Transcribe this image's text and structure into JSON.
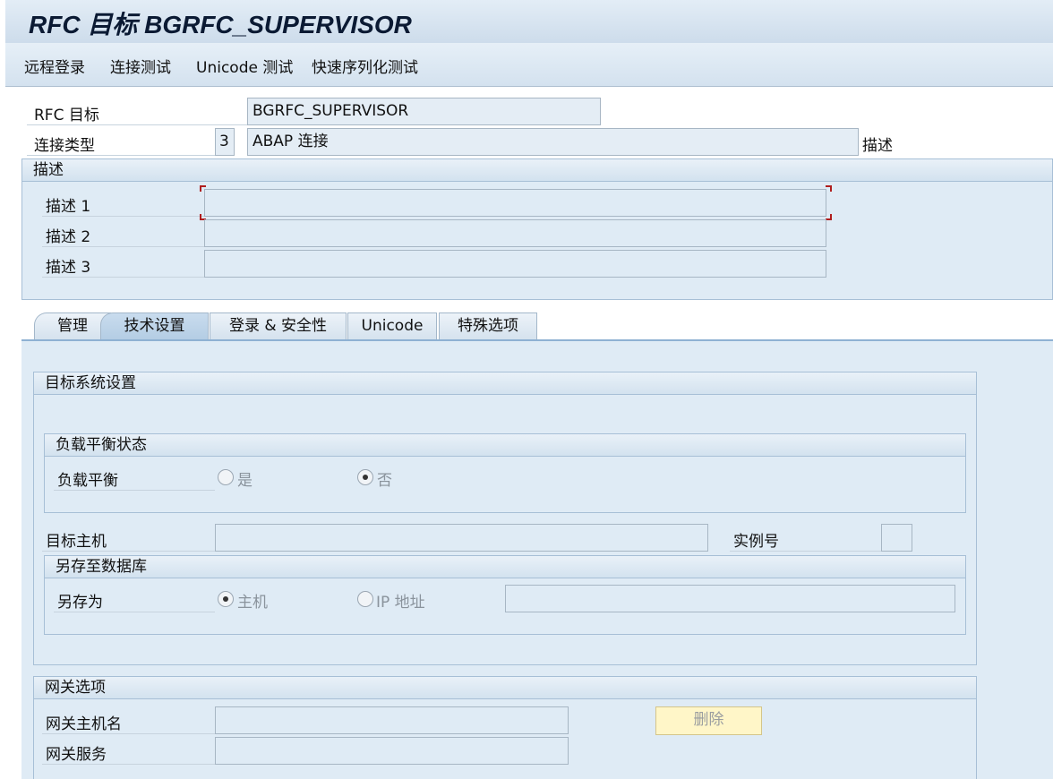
{
  "window": {
    "title": "RFC 目标 BGRFC_SUPERVISOR"
  },
  "toolbar": {
    "items": [
      "远程登录",
      "连接测试",
      "Unicode 测试",
      "快速序列化测试"
    ]
  },
  "header": {
    "rfc_dest_label": "RFC 目标",
    "rfc_dest_value": "BGRFC_SUPERVISOR",
    "conn_type_label": "连接类型",
    "conn_type_code": "3",
    "conn_type_text": "ABAP 连接",
    "desc_button": "描述"
  },
  "description": {
    "title": "描述",
    "rows": [
      {
        "label": "描述 1",
        "value": ""
      },
      {
        "label": "描述 2",
        "value": ""
      },
      {
        "label": "描述 3",
        "value": ""
      }
    ]
  },
  "tabs": [
    "管理",
    "技术设置",
    "登录 & 安全性",
    "Unicode",
    "特殊选项"
  ],
  "active_tab": "技术设置",
  "target_system": {
    "title": "目标系统设置",
    "load_balance_group": {
      "title": "负载平衡状态",
      "label": "负载平衡",
      "options": [
        "是",
        "否"
      ],
      "selected": "否"
    },
    "target_host_label": "目标主机",
    "target_host_value": "",
    "instance_label": "实例号",
    "instance_value": "",
    "save_db_group": {
      "title": "另存至数据库",
      "label": "另存为",
      "options": [
        "主机",
        "IP 地址"
      ],
      "selected": "主机",
      "value": ""
    }
  },
  "gateway": {
    "title": "网关选项",
    "host_label": "网关主机名",
    "host_value": "",
    "service_label": "网关服务",
    "service_value": "",
    "delete_button": "删除"
  },
  "colors": {
    "panel_bg": "#dfebf5",
    "title_text": "#0b1a33",
    "focus_marker": "#b01e1e",
    "delete_button_bg": "#fff6c8"
  }
}
